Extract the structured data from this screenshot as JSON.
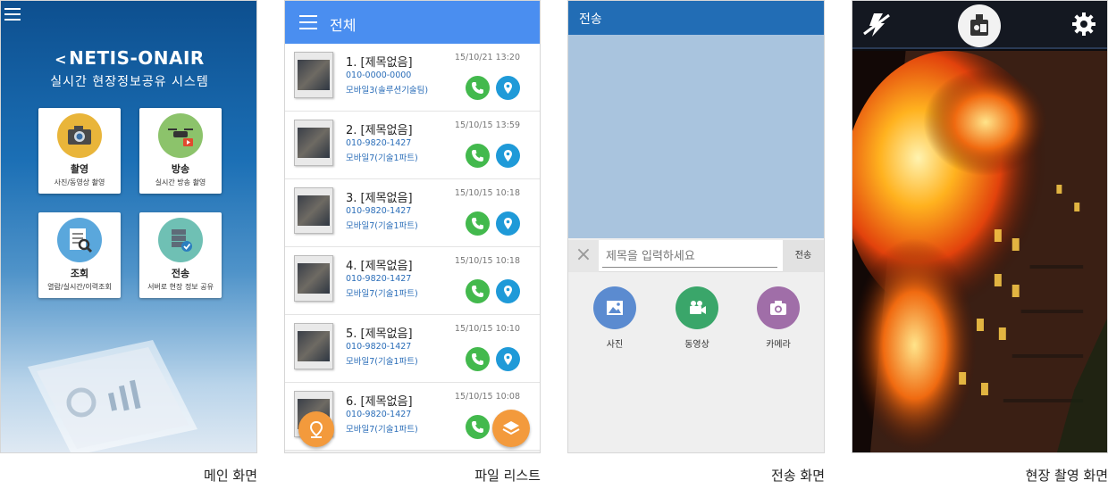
{
  "main_screen": {
    "logo": "NETIS-ONAIR",
    "subtitle": "실시간 현장정보공유 시스템",
    "tiles": [
      {
        "title": "촬영",
        "desc": "사진/동영상 촬영",
        "icon": "camera-icon",
        "color": "#e9b53a"
      },
      {
        "title": "방송",
        "desc": "실시간 방송 촬영",
        "icon": "drone-icon",
        "color": "#8cc36b"
      },
      {
        "title": "조회",
        "desc": "열람/실시간/이력조회",
        "icon": "document-search-icon",
        "color": "#5aa7dc"
      },
      {
        "title": "전송",
        "desc": "서버로 현장 정보 공유",
        "icon": "server-check-icon",
        "color": "#6fc0b4"
      }
    ]
  },
  "file_list": {
    "title": "전체",
    "items": [
      {
        "name": "1. [제목없음]",
        "phone": "010-0000-0000",
        "dept": "모바일3(솔루션기술팀)",
        "date": "15/10/21 13:20"
      },
      {
        "name": "2. [제목없음]",
        "phone": "010-9820-1427",
        "dept": "모바일7(기술1파트)",
        "date": "15/10/15 13:59"
      },
      {
        "name": "3. [제목없음]",
        "phone": "010-9820-1427",
        "dept": "모바일7(기술1파트)",
        "date": "15/10/15 10:18"
      },
      {
        "name": "4. [제목없음]",
        "phone": "010-9820-1427",
        "dept": "모바일7(기술1파트)",
        "date": "15/10/15 10:18"
      },
      {
        "name": "5. [제목없음]",
        "phone": "010-9820-1427",
        "dept": "모바일7(기술1파트)",
        "date": "15/10/15 10:10"
      },
      {
        "name": "6. [제목없음]",
        "phone": "010-9820-1427",
        "dept": "모바일7(기술1파트)",
        "date": "15/10/15 10:08"
      }
    ]
  },
  "send_screen": {
    "title": "전송",
    "input_placeholder": "제목을 입력하세요",
    "send_label": "전송",
    "actions": [
      {
        "label": "사진",
        "icon": "image-icon",
        "color": "#5b8bd0"
      },
      {
        "label": "동영상",
        "icon": "video-camera-icon",
        "color": "#3aa66a"
      },
      {
        "label": "카메라",
        "icon": "camera-icon",
        "color": "#a06ea8"
      }
    ]
  },
  "capture_screen": {
    "icons": [
      "flash-off-icon",
      "camera-switch-icon",
      "gear-icon"
    ]
  },
  "captions": {
    "main": "메인 화면",
    "file_list": "파일 리스트",
    "send": "전송 화면",
    "capture": "현장 촬영 화면"
  }
}
